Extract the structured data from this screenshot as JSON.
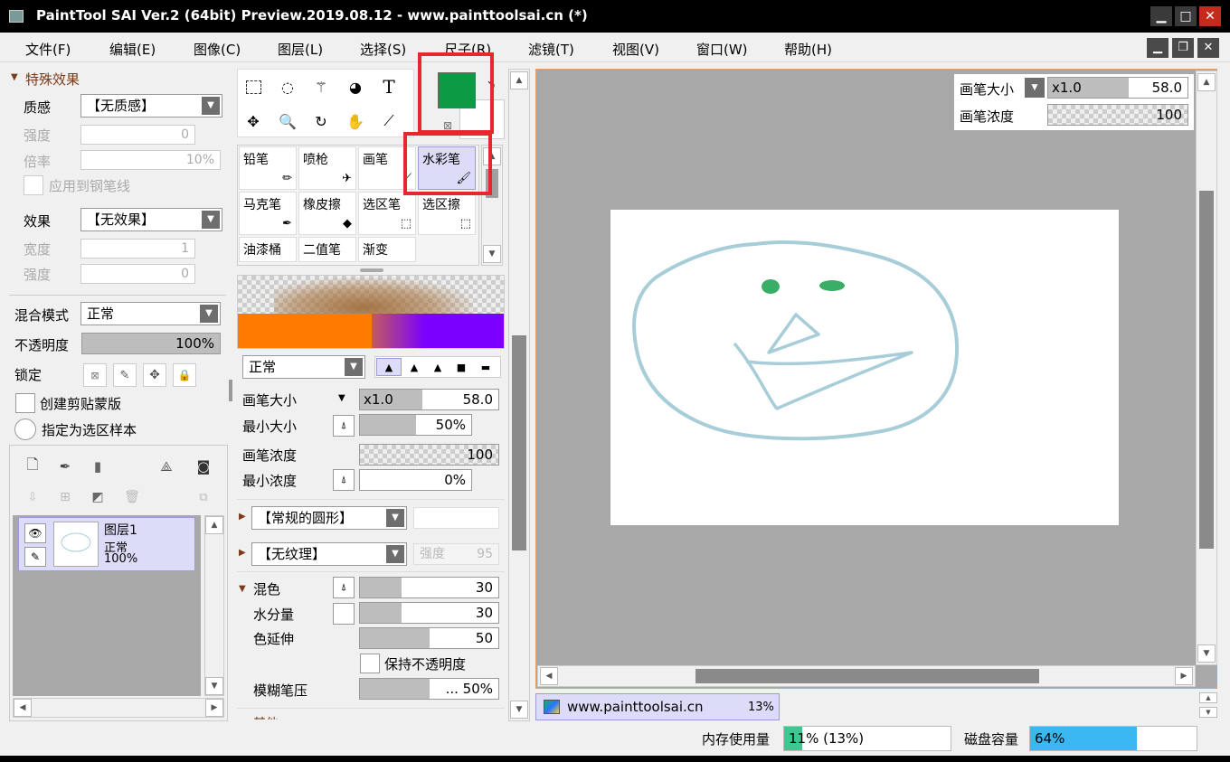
{
  "window": {
    "title": "PaintTool SAI Ver.2 (64bit) Preview.2019.08.12 - www.painttoolsai.cn (*)",
    "min_glyph": "▁",
    "max_glyph": "□",
    "close_glyph": "✕"
  },
  "menu": [
    {
      "label": "文件(F)"
    },
    {
      "label": "编辑(E)"
    },
    {
      "label": "图像(C)"
    },
    {
      "label": "图层(L)"
    },
    {
      "label": "选择(S)"
    },
    {
      "label": "尺子(R)"
    },
    {
      "label": "滤镜(T)"
    },
    {
      "label": "视图(V)"
    },
    {
      "label": "窗口(W)"
    },
    {
      "label": "帮助(H)"
    }
  ],
  "mdi": {
    "min_glyph": "▁",
    "restore_glyph": "❐",
    "close_glyph": "✕"
  },
  "effects": {
    "header": "特殊效果",
    "texture_label": "质感",
    "texture_value": "【无质感】",
    "strength_label": "强度",
    "strength_value": "0",
    "scale_label": "倍率",
    "scale_value": "10%",
    "apply_pen_label": "应用到钢笔线",
    "effect_label": "效果",
    "effect_value": "【无效果】",
    "width_label": "宽度",
    "width_value": "1",
    "strength2_label": "强度",
    "strength2_value": "0"
  },
  "layer_props": {
    "blend_label": "混合模式",
    "blend_value": "正常",
    "opacity_label": "不透明度",
    "opacity_value": "100%",
    "opacity_fraction": 1.0,
    "lock_label": "锁定",
    "clip_label": "创建剪贴蒙版",
    "sample_label": "指定为选区样本"
  },
  "layers": [
    {
      "name": "图层1",
      "mode": "正常",
      "opacity": "100%"
    }
  ],
  "tools_panel": {
    "text_tool_glyph": "T"
  },
  "brushes": [
    {
      "label": "铅笔"
    },
    {
      "label": "喷枪"
    },
    {
      "label": "画笔"
    },
    {
      "label": "水彩笔"
    },
    {
      "label": "马克笔"
    },
    {
      "label": "橡皮擦"
    },
    {
      "label": "选区笔"
    },
    {
      "label": "选区擦"
    },
    {
      "label": "油漆桶"
    },
    {
      "label": "二值笔"
    },
    {
      "label": "渐变"
    }
  ],
  "colors": {
    "primary": "#0c9a44",
    "orange": "#ff7a00",
    "purple": "#7a00ff",
    "highlight": "#e8262e"
  },
  "brush_settings": {
    "blend_value": "正常",
    "size_label": "画笔大小",
    "size_mult": "x1.0",
    "size_value": "58.0",
    "size_fraction": 0.45,
    "min_size_label": "最小大小",
    "min_size_value": "50%",
    "min_size_fraction": 0.5,
    "density_label": "画笔浓度",
    "density_value": "100",
    "min_density_label": "最小浓度",
    "min_density_value": "0%",
    "shape_value": "【常规的圆形】",
    "texture_value": "【无纹理】",
    "texture_strength_label": "强度",
    "texture_strength_value": "95",
    "mix_label": "混色",
    "mix_value": "30",
    "mix_fraction": 0.3,
    "water_label": "水分量",
    "water_value": "30",
    "water_fraction": 0.3,
    "stretch_label": "色延伸",
    "stretch_value": "50",
    "stretch_fraction": 0.5,
    "keep_opacity_label": "保持不透明度",
    "blur_label": "模糊笔压",
    "blur_value": "... 50%",
    "blur_fraction": 0.5,
    "other_label": "其他"
  },
  "canvas_overlay": {
    "size_label": "画笔大小",
    "size_mult": "x1.0",
    "size_value": "58.0",
    "density_label": "画笔浓度",
    "density_value": "100"
  },
  "doc_tab": {
    "name": "www.painttoolsai.cn",
    "zoom": "13%"
  },
  "status": {
    "memory_label": "内存使用量",
    "memory_value": "11% (13%)",
    "memory_fraction": 0.11,
    "disk_label": "磁盘容量",
    "disk_value": "64%",
    "disk_fraction": 0.64
  }
}
